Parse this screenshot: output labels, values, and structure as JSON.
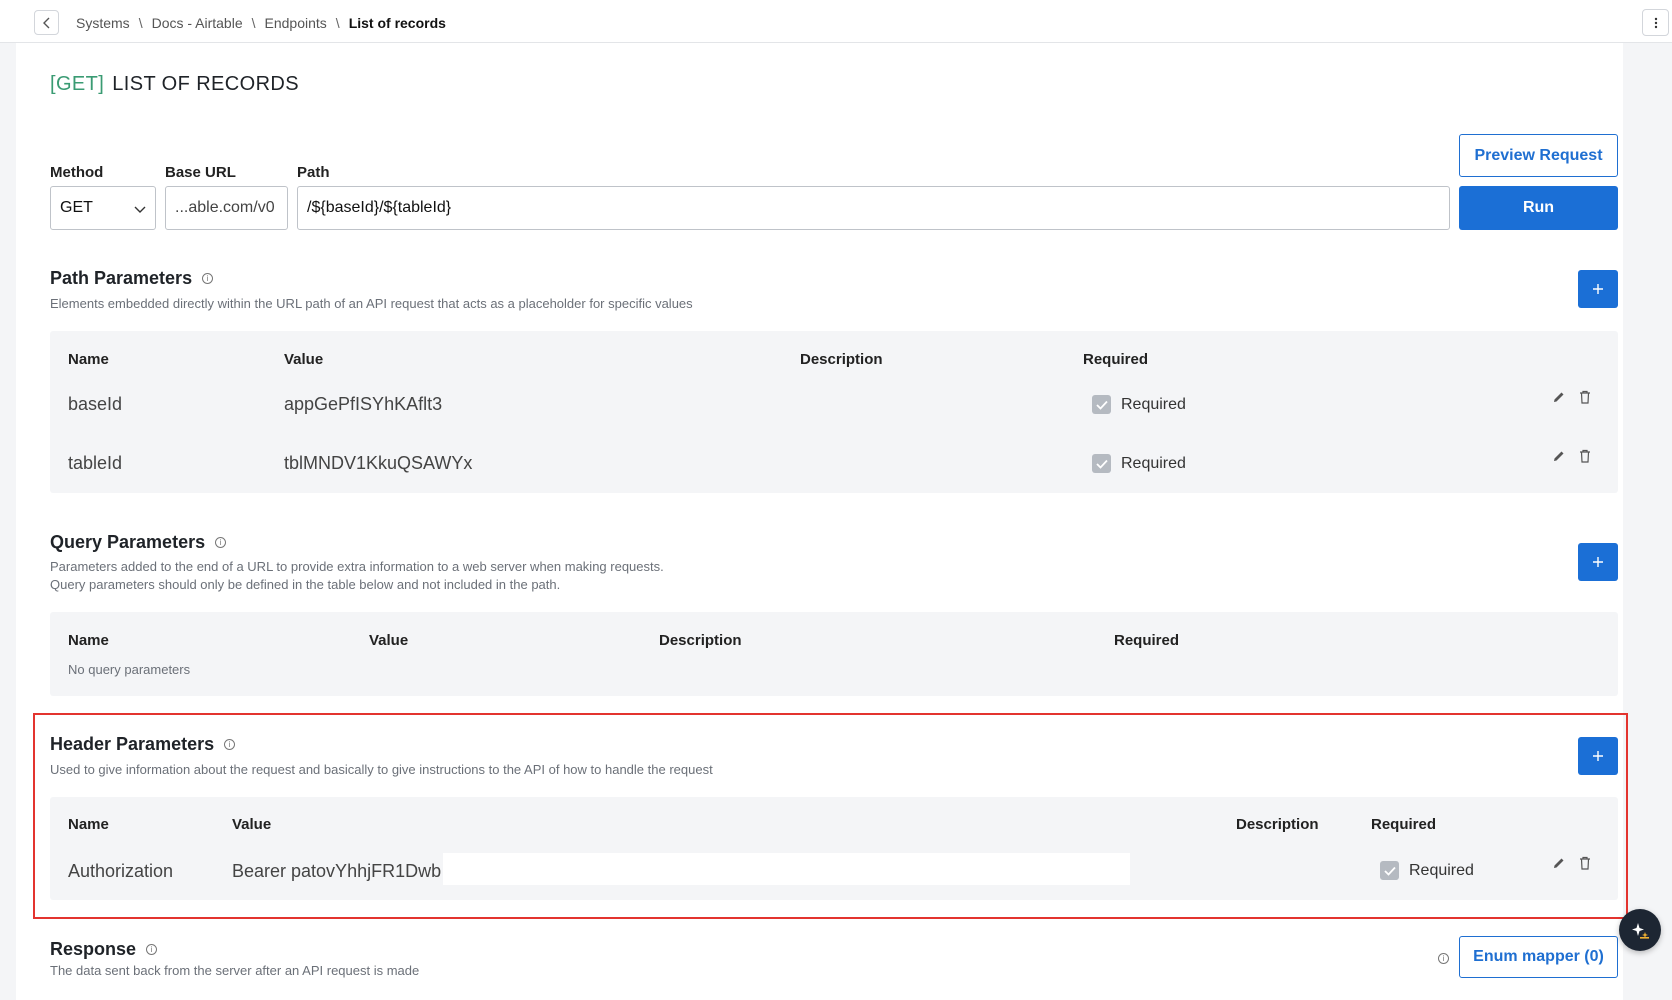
{
  "breadcrumb": {
    "items": [
      "Systems",
      "Docs - Airtable",
      "Endpoints"
    ],
    "current": "List of records",
    "separator": "\\"
  },
  "title": {
    "method": "[GET]",
    "name": "LIST OF RECORDS"
  },
  "request": {
    "method_label": "Method",
    "method_value": "GET",
    "base_url_label": "Base URL",
    "base_url_value": "...able.com/v0",
    "path_label": "Path",
    "path_value": "/${baseId}/${tableId}",
    "preview_label": "Preview Request",
    "run_label": "Run"
  },
  "path_params": {
    "title": "Path Parameters",
    "description": "Elements embedded directly within the URL path of an API request that acts as a placeholder for specific values",
    "columns": [
      "Name",
      "Value",
      "Description",
      "Required"
    ],
    "rows": [
      {
        "name": "baseId",
        "value": "appGePfISYhKAflt3",
        "description": "",
        "required": "Required"
      },
      {
        "name": "tableId",
        "value": "tblMNDV1KkuQSAWYx",
        "description": "",
        "required": "Required"
      }
    ]
  },
  "query_params": {
    "title": "Query Parameters",
    "description_line1": "Parameters added to the end of a URL to provide extra information to a web server when making requests.",
    "description_line2": "Query parameters should only be defined in the table below and not included in the path.",
    "columns": [
      "Name",
      "Value",
      "Description",
      "Required"
    ],
    "empty": "No query parameters"
  },
  "header_params": {
    "title": "Header Parameters",
    "description": "Used to give information about the request and basically to give instructions to the API of how to handle the request",
    "columns": [
      "Name",
      "Value",
      "Description",
      "Required"
    ],
    "rows": [
      {
        "name": "Authorization",
        "value": "Bearer patovYhhjFR1Dwb",
        "description": "",
        "required": "Required"
      }
    ]
  },
  "response": {
    "title": "Response",
    "description": "The data sent back from the server after an API request is made",
    "enum_mapper_label": "Enum mapper (0)"
  },
  "icons": {
    "back": "chevron-left-icon",
    "more": "kebab-icon",
    "info": "info-icon",
    "edit": "pencil-icon",
    "delete": "trash-icon",
    "add": "plus-icon",
    "assistant": "sparkle-icon"
  },
  "colors": {
    "accent": "#1b6fd6",
    "method_green": "#3a9b73",
    "highlight_red": "#e3342f"
  }
}
